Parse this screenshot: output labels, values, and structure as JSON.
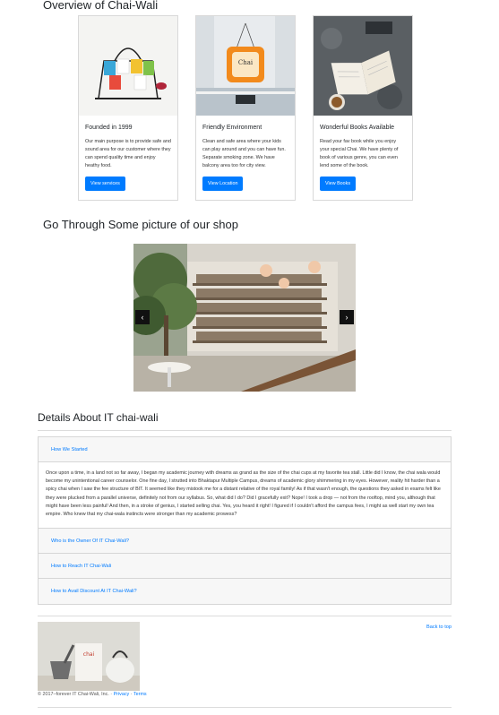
{
  "overview": {
    "title": "Overview of Chai-Wali"
  },
  "cards": [
    {
      "title": "Founded in 1999",
      "text": "Our main purpose is to provide safe and sound area for our customer where they can spend quality time and enjoy heathy food.",
      "button": "View services"
    },
    {
      "title": "Friendly Environment",
      "text": "Clean and safe area where your kids can play around and you can have fun. Separate smoking zone. We have balcony area too for city view.",
      "button": "View Location"
    },
    {
      "title": "Wonderful Books Available",
      "text": "Read your fav book while you enjoy your special Chai. We have plenty of book of various genre, you can even lend some of the book.",
      "button": "View Books"
    }
  ],
  "gallery": {
    "title": "Go Through Some picture of our shop",
    "prev": "‹",
    "next": "›"
  },
  "details": {
    "title": "Details About IT chai-wali",
    "items": [
      {
        "heading": "How We Started",
        "body": "Once upon a time, in a land not so far away, I began my academic journey with dreams as grand as the size of the chai cups at my favorite tea stall. Little did I know, the chai wala would become my unintentional career counselor. One fine day, I strutted into Bhaktapur Multiple Campus, dreams of academic glory shimmering in my eyes. However, reality hit harder than a spicy chai when I saw the fee structure of BIT. It seemed like they mistook me for a distant relative of the royal family! As if that wasn't enough, the questions they asked in exams felt like they were plucked from a parallel universe, definitely not from our syllabus. So, what did I do? Did I gracefully exit? Nope! I took a drop — not from the rooftop, mind you, although that might have been less painful! And then, in a stroke of genius, I started selling chai. Yes, you heard it right! I figured if I couldn't afford the campus fees, I might as well start my own tea empire. Who knew that my chai-wala instincts were stronger than my academic prowess?"
      },
      {
        "heading": "Who is the Owner Of IT Chai-Wali?"
      },
      {
        "heading": "How to Reach IT Chai-Wali"
      },
      {
        "heading": "How to Avail Discount At IT Chai-Wali?"
      }
    ]
  },
  "footer": {
    "back_to_top": "Back to top",
    "copyright": "© 2017–forever IT Chai-Wali, Inc. · ",
    "privacy": "Privacy",
    "sep": " · ",
    "terms": "Terms"
  },
  "colors": {
    "primary": "#007bff",
    "accordion_bg": "#f7f7f7"
  }
}
